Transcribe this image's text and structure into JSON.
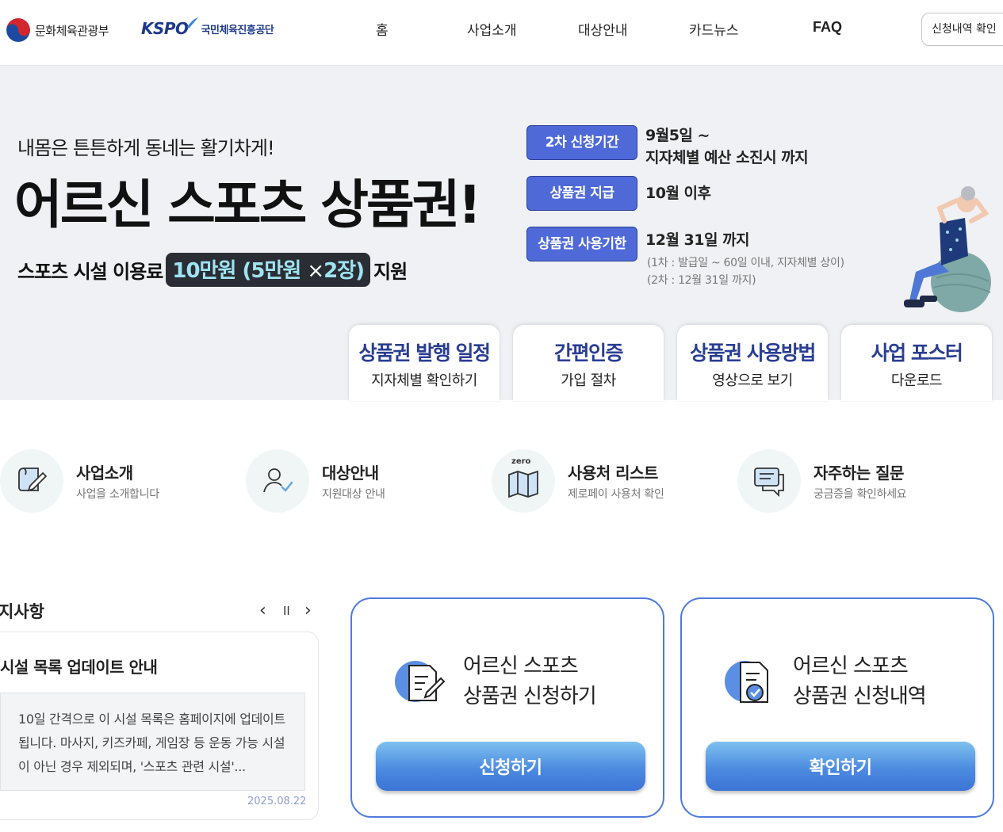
{
  "header": {
    "ministry": "문화체육관광부",
    "kspo": "KSPO",
    "kspo_name": "국민체육진흥공단",
    "nav": [
      "홈",
      "사업소개",
      "대상안내",
      "카드뉴스",
      "FAQ"
    ],
    "check_button": "신청내역 확인"
  },
  "hero": {
    "tagline": "내몸은 튼튼하게 동네는 활기차게!",
    "headline": "어르신 스포츠 상품권!",
    "support_prefix": "스포츠 시설 이용료",
    "support_amount": "10만원",
    "support_detail": "(5만원",
    "support_x": "×",
    "support_count": "2장)",
    "support_suffix": "지원",
    "schedule": [
      {
        "tag": "2차 신청기간",
        "lines": [
          "9월5일 ~",
          "지자체별 예산 소진시 까지"
        ]
      },
      {
        "tag": "상품권 지급",
        "lines": [
          "10월 이후"
        ]
      },
      {
        "tag": "상품권 사용기한",
        "lines": [
          "12월 31일 까지"
        ],
        "notes": [
          "(1차 : 발급일 ~ 60일 이내, 지자체별 상이)",
          "(2차 : 12월 31일 까지)"
        ]
      }
    ],
    "tabs": [
      {
        "title": "상품권 발행 일정",
        "sub": "지자체별 확인하기"
      },
      {
        "title": "간편인증",
        "sub": "가입 절차"
      },
      {
        "title": "상품권 사용방법",
        "sub": "영상으로 보기"
      },
      {
        "title": "사업 포스터",
        "sub": "다운로드"
      }
    ]
  },
  "shortcuts": [
    {
      "title": "사업소개",
      "desc": "사업을 소개합니다",
      "icon": "document-pen-icon"
    },
    {
      "title": "대상안내",
      "desc": "지원대상 안내",
      "icon": "user-check-icon"
    },
    {
      "title": "사용처 리스트",
      "desc": "제로페이 사용처 확인",
      "icon": "zero-map-icon",
      "badge": "zero"
    },
    {
      "title": "자주하는 질문",
      "desc": "궁금증을 확인하세요",
      "icon": "chat-icon"
    }
  ],
  "notice": {
    "title": "지사항",
    "controls": {
      "prev": "‹",
      "pause": "II",
      "next": "›"
    },
    "item_title": "시설 목록 업데이트 안내",
    "item_body": "10일 간격으로 이 시설 목록은 홈페이지에 업데이트 됩니다. 마사지, 키즈카페, 게임장 등 운동 가능 시설이 아닌 경우 제외되며, '스포츠 관련 시설'...",
    "item_date": "2025.08.22"
  },
  "actions": [
    {
      "line1": "어르신 스포츠",
      "line2": "상품권 신청하기",
      "button": "신청하기",
      "icon": "apply-document-icon"
    },
    {
      "line1": "어르신 스포츠",
      "line2": "상품권 신청내역",
      "button": "확인하기",
      "icon": "check-document-icon"
    }
  ],
  "colors": {
    "accent": "#4f6ad8",
    "headline_tab": "#2a3e92",
    "action_border": "#4f7bdc",
    "hero_bg": "#eff1f4"
  }
}
